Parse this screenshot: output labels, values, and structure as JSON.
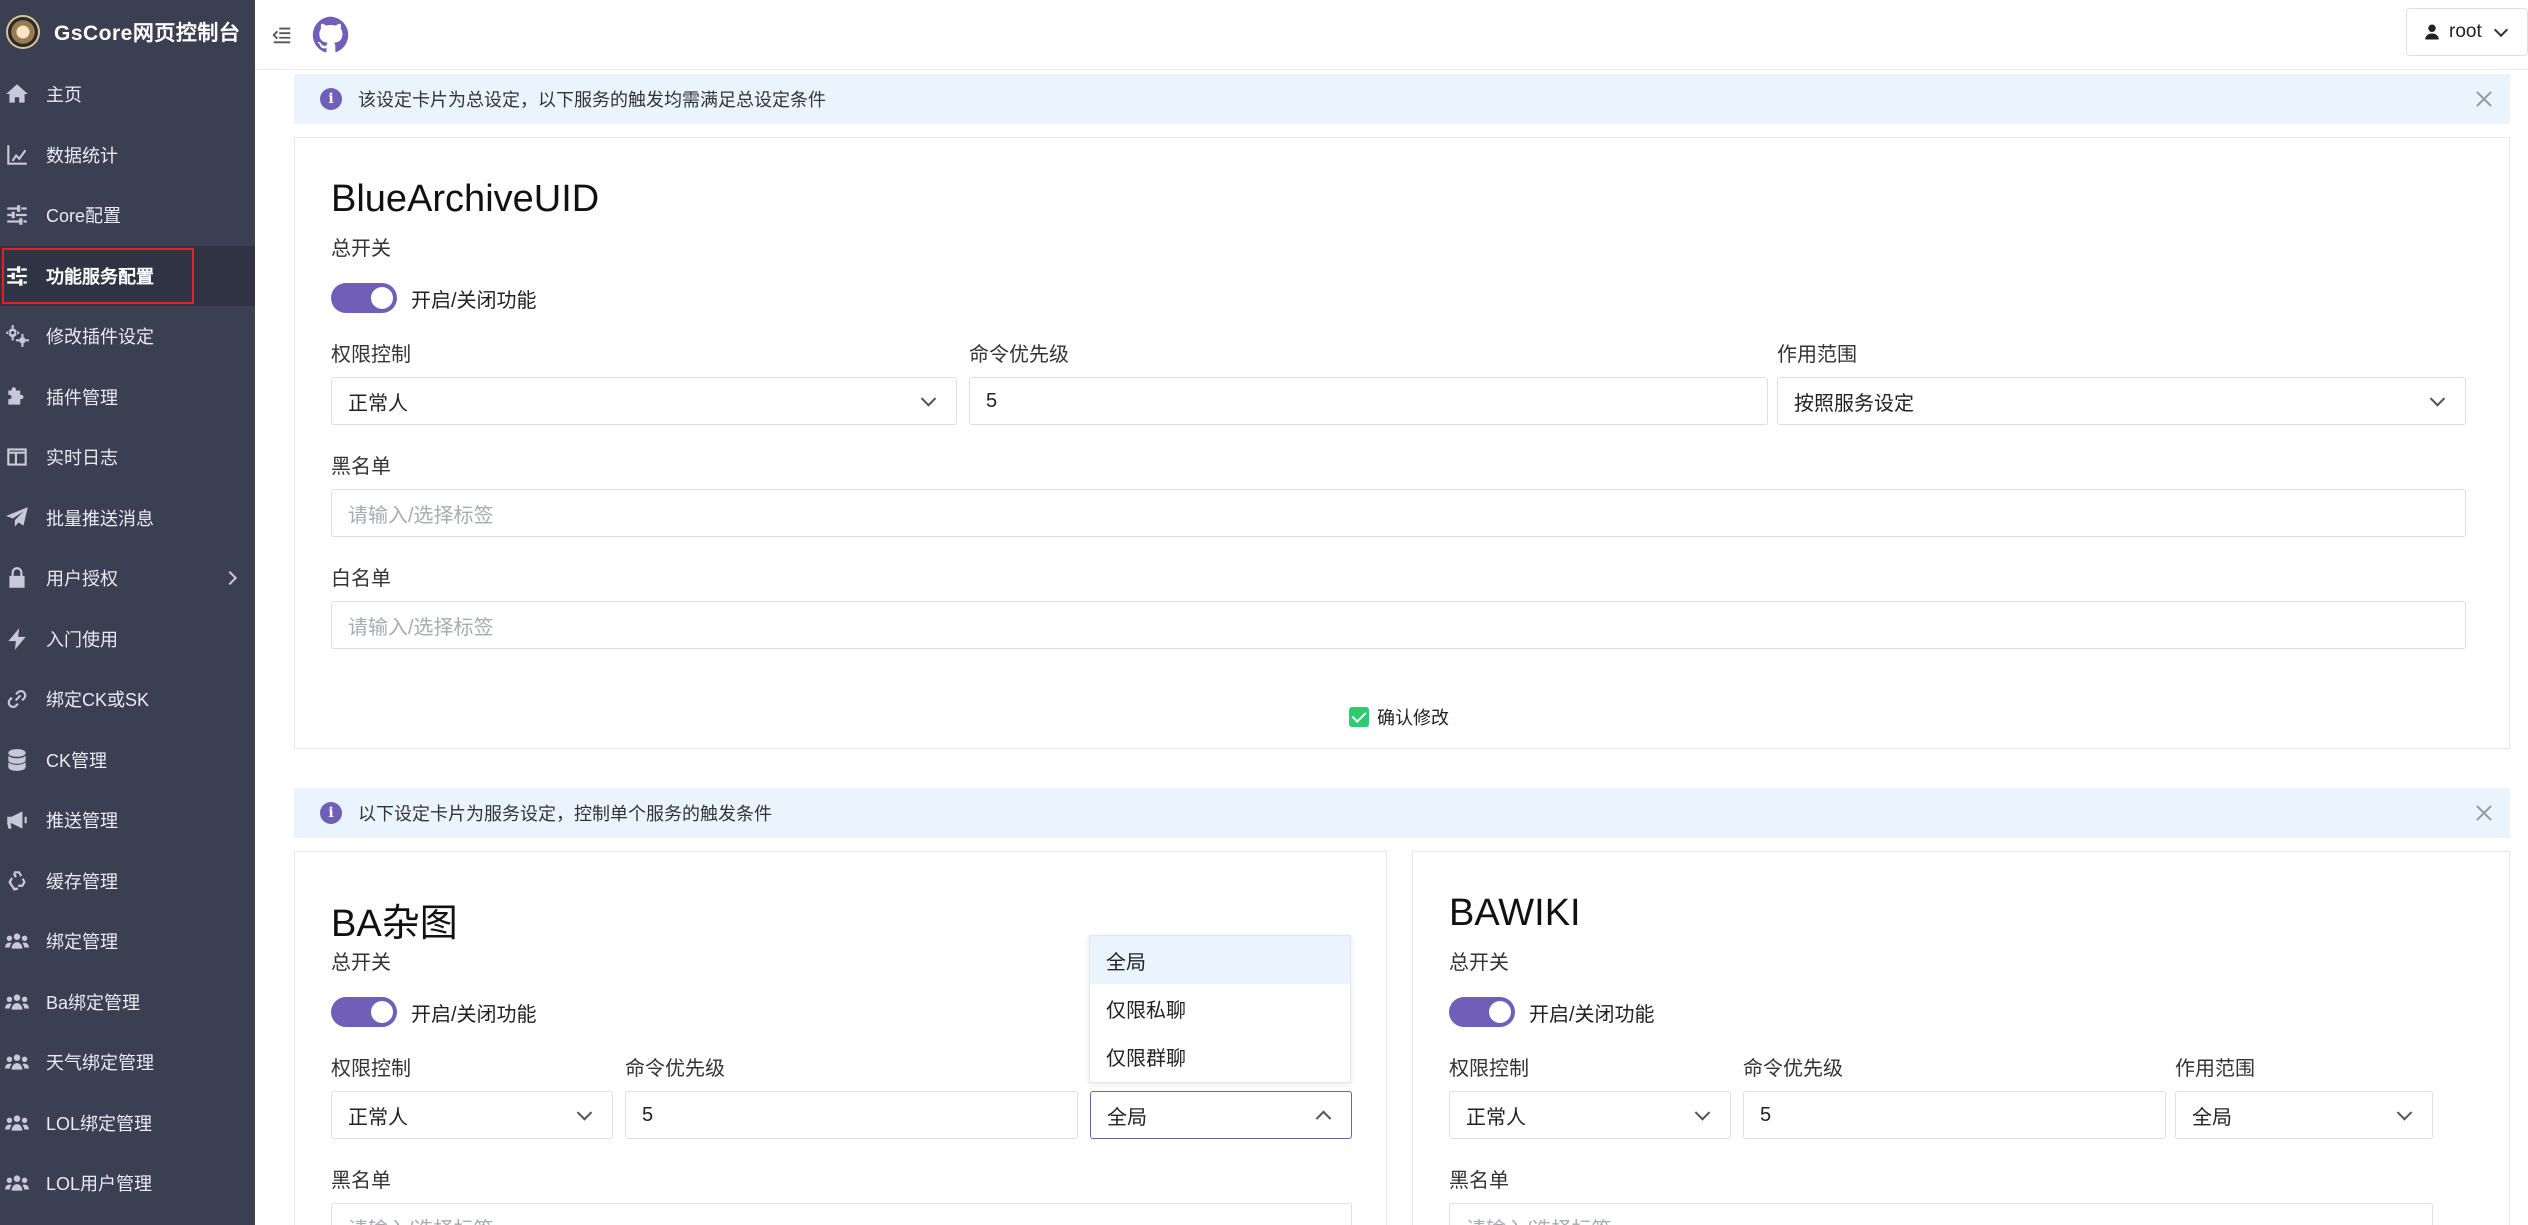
{
  "app": {
    "title": "GsCore网页控制台"
  },
  "sidebar": {
    "items": [
      {
        "label": "主页",
        "icon": "home-icon"
      },
      {
        "label": "数据统计",
        "icon": "chart-icon"
      },
      {
        "label": "Core配置",
        "icon": "sliders-icon"
      },
      {
        "label": "功能服务配置",
        "icon": "sliders-icon"
      },
      {
        "label": "修改插件设定",
        "icon": "gears-icon"
      },
      {
        "label": "插件管理",
        "icon": "puzzle-icon"
      },
      {
        "label": "实时日志",
        "icon": "table-icon"
      },
      {
        "label": "批量推送消息",
        "icon": "paper-plane-icon"
      },
      {
        "label": "用户授权",
        "icon": "lock-icon"
      },
      {
        "label": "入门使用",
        "icon": "bolt-icon"
      },
      {
        "label": "绑定CK或SK",
        "icon": "link-icon"
      },
      {
        "label": "CK管理",
        "icon": "database-icon"
      },
      {
        "label": "推送管理",
        "icon": "megaphone-icon"
      },
      {
        "label": "缓存管理",
        "icon": "recycle-icon"
      },
      {
        "label": "绑定管理",
        "icon": "users-icon"
      },
      {
        "label": "Ba绑定管理",
        "icon": "users-icon"
      },
      {
        "label": "天气绑定管理",
        "icon": "users-icon"
      },
      {
        "label": "LOL绑定管理",
        "icon": "users-icon"
      },
      {
        "label": "LOL用户管理",
        "icon": "users-icon"
      }
    ],
    "active_index": 3
  },
  "header": {
    "user": "root"
  },
  "alerts": {
    "global": "该设定卡片为总设定，以下服务的触发均需满足总设定条件",
    "service": "以下设定卡片为服务设定，控制单个服务的触发条件"
  },
  "main_card": {
    "title": "BlueArchiveUID",
    "master_switch_label": "总开关",
    "toggle_label": "开启/关闭功能",
    "permission_label": "权限控制",
    "permission_value": "正常人",
    "priority_label": "命令优先级",
    "priority_value": "5",
    "scope_label": "作用范围",
    "scope_value": "按照服务设定",
    "blacklist_label": "黑名单",
    "whitelist_label": "白名单",
    "tag_placeholder": "请输入/选择标签",
    "confirm_label": "确认修改"
  },
  "service_cards": [
    {
      "title": "BA杂图",
      "master_switch_label": "总开关",
      "toggle_label": "开启/关闭功能",
      "permission_label": "权限控制",
      "permission_value": "正常人",
      "priority_label": "命令优先级",
      "priority_value": "5",
      "scope_value": "全局",
      "blacklist_label": "黑名单",
      "tag_placeholder": "请输入/选择标签"
    },
    {
      "title": "BAWIKI",
      "master_switch_label": "总开关",
      "toggle_label": "开启/关闭功能",
      "permission_label": "权限控制",
      "permission_value": "正常人",
      "priority_label": "命令优先级",
      "priority_value": "5",
      "scope_label": "作用范围",
      "scope_value": "全局",
      "blacklist_label": "黑名单",
      "tag_placeholder": "请输入/选择标签"
    }
  ],
  "scope_dropdown": {
    "options": [
      "全局",
      "仅限私聊",
      "仅限群聊"
    ],
    "selected": "全局"
  },
  "colors": {
    "accent": "#6f5fb8",
    "sidebar_bg": "#3a3f51",
    "alert_bg": "#eaf4ff",
    "confirm_green": "#2ecc71"
  }
}
